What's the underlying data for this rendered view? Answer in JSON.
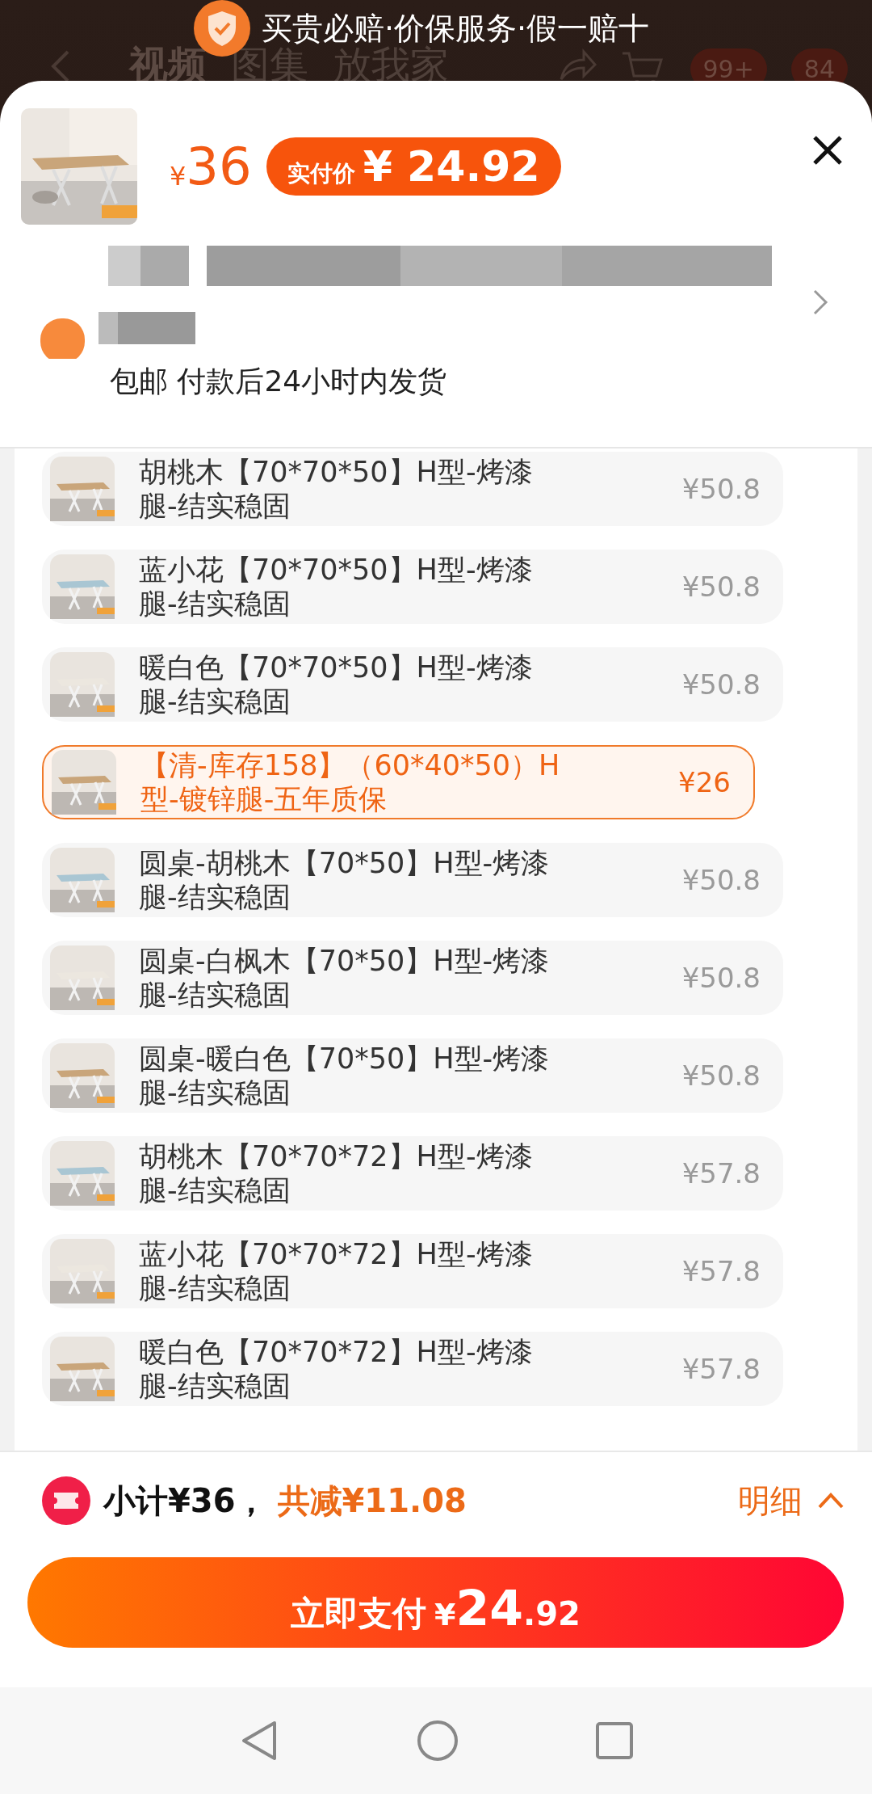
{
  "banner": {
    "text": "买贵必赔·价保服务·假一赔十"
  },
  "background_header": {
    "tabs": [
      {
        "label": "视频",
        "selected": true
      },
      {
        "label": "图集",
        "selected": false
      },
      {
        "label": "放我家",
        "selected": false
      }
    ],
    "badges": [
      "99+",
      "84"
    ]
  },
  "product": {
    "currency": "¥",
    "price": "36",
    "final_label": "实付价",
    "final_price": "¥ 24.92"
  },
  "shipping": "包邮 付款后24小时内发货",
  "options": [
    {
      "name": "胡桃木【70*70*50】H型-烤漆腿-结实稳固",
      "price": "¥50.8",
      "selected": false
    },
    {
      "name": "蓝小花【70*70*50】H型-烤漆腿-结实稳固",
      "price": "¥50.8",
      "selected": false
    },
    {
      "name": "暖白色【70*70*50】H型-烤漆腿-结实稳固",
      "price": "¥50.8",
      "selected": false
    },
    {
      "name": "【清-库存158】（60*40*50）H型-镀锌腿-五年质保",
      "price": "¥26",
      "selected": true
    },
    {
      "name": "圆桌-胡桃木【70*50】H型-烤漆腿-结实稳固",
      "price": "¥50.8",
      "selected": false
    },
    {
      "name": "圆桌-白枫木【70*50】H型-烤漆腿-结实稳固",
      "price": "¥50.8",
      "selected": false
    },
    {
      "name": "圆桌-暖白色【70*50】H型-烤漆腿-结实稳固",
      "price": "¥50.8",
      "selected": false
    },
    {
      "name": "胡桃木【70*70*72】H型-烤漆腿-结实稳固",
      "price": "¥57.8",
      "selected": false
    },
    {
      "name": "蓝小花【70*70*72】H型-烤漆腿-结实稳固",
      "price": "¥57.8",
      "selected": false
    },
    {
      "name": "暖白色【70*70*72】H型-烤漆腿-结实稳固",
      "price": "¥57.8",
      "selected": false
    }
  ],
  "summary": {
    "subtotal": "小计¥36，",
    "discount": "共减¥11.08",
    "details": "明细"
  },
  "pay_button": {
    "label": "立即支付",
    "currency": "¥",
    "integer": "24",
    "decimal": ".92"
  }
}
